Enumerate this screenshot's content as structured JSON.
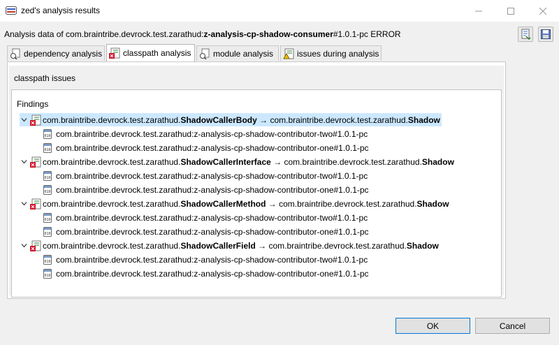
{
  "window": {
    "title": "zed's analysis results"
  },
  "header": {
    "prefix": "Analysis data of com.braintribe.devrock.test.zarathud:",
    "artifact": "z-analysis-cp-shadow-consumer",
    "suffix": "#1.0.1-pc ERROR"
  },
  "tabs": [
    {
      "label": "dependency analysis",
      "icon": "dependency-icon"
    },
    {
      "label": "classpath analysis",
      "icon": "classpath-error-icon",
      "active": true
    },
    {
      "label": "module analysis",
      "icon": "module-icon"
    },
    {
      "label": "issues during analysis",
      "icon": "issues-icon"
    }
  ],
  "panel": {
    "title": "classpath issues",
    "findings_label": "Findings"
  },
  "findings": [
    {
      "prefix": "com.braintribe.devrock.test.zarathud.",
      "caller": "ShadowCallerBody",
      "arrow": " → com.braintribe.devrock.test.zarathud.",
      "target": "Shadow",
      "selected": true,
      "children": [
        "com.braintribe.devrock.test.zarathud:z-analysis-cp-shadow-contributor-two#1.0.1-pc",
        "com.braintribe.devrock.test.zarathud:z-analysis-cp-shadow-contributor-one#1.0.1-pc"
      ]
    },
    {
      "prefix": "com.braintribe.devrock.test.zarathud.",
      "caller": "ShadowCallerInterface",
      "arrow": " → com.braintribe.devrock.test.zarathud.",
      "target": "Shadow",
      "children": [
        "com.braintribe.devrock.test.zarathud:z-analysis-cp-shadow-contributor-two#1.0.1-pc",
        "com.braintribe.devrock.test.zarathud:z-analysis-cp-shadow-contributor-one#1.0.1-pc"
      ]
    },
    {
      "prefix": "com.braintribe.devrock.test.zarathud.",
      "caller": "ShadowCallerMethod",
      "arrow": " → com.braintribe.devrock.test.zarathud.",
      "target": "Shadow",
      "children": [
        "com.braintribe.devrock.test.zarathud:z-analysis-cp-shadow-contributor-two#1.0.1-pc",
        "com.braintribe.devrock.test.zarathud:z-analysis-cp-shadow-contributor-one#1.0.1-pc"
      ]
    },
    {
      "prefix": "com.braintribe.devrock.test.zarathud.",
      "caller": "ShadowCallerField",
      "arrow": " → com.braintribe.devrock.test.zarathud.",
      "target": "Shadow",
      "children": [
        "com.braintribe.devrock.test.zarathud:z-analysis-cp-shadow-contributor-two#1.0.1-pc",
        "com.braintribe.devrock.test.zarathud:z-analysis-cp-shadow-contributor-one#1.0.1-pc"
      ]
    }
  ],
  "buttons": {
    "ok": "OK",
    "cancel": "Cancel"
  },
  "colors": {
    "selection": "#cce8ff",
    "ok_border": "#0078d7",
    "error": "#d0122a"
  }
}
